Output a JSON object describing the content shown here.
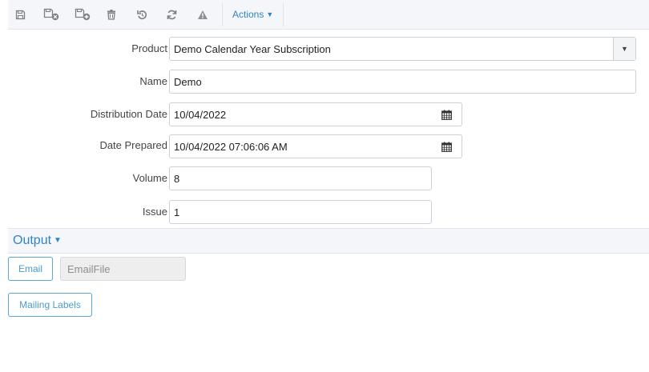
{
  "toolbar": {
    "buttons": [
      {
        "name": "save-icon"
      },
      {
        "name": "save-close-icon"
      },
      {
        "name": "save-new-icon"
      },
      {
        "name": "delete-icon"
      },
      {
        "name": "undo-icon"
      },
      {
        "name": "refresh-icon"
      },
      {
        "name": "warning-icon"
      }
    ],
    "actions_label": "Actions",
    "icon_color": "#7b8088",
    "accent_color": "#2f84c6"
  },
  "form": {
    "product": {
      "label": "Product",
      "value": "Demo Calendar Year Subscription"
    },
    "name": {
      "label": "Name",
      "value": "Demo"
    },
    "distribution_date": {
      "label": "Distribution Date",
      "value": "10/04/2022"
    },
    "date_prepared": {
      "label": "Date Prepared",
      "value": "10/04/2022 07:06:06 AM"
    },
    "volume": {
      "label": "Volume",
      "value": "8"
    },
    "issue": {
      "label": "Issue",
      "value": "1"
    }
  },
  "output": {
    "title": "Output",
    "email_button": "Email",
    "email_file_value": "EmailFile",
    "mailing_labels_button": "Mailing Labels"
  }
}
